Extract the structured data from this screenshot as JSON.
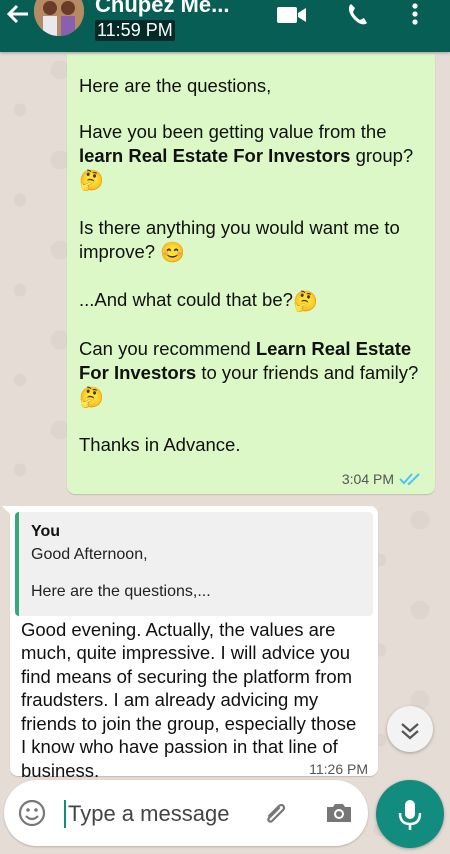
{
  "header": {
    "chat_name": "Chupez Me...",
    "time": "11:59 PM",
    "icons": [
      "back-arrow-icon",
      "video-call-icon",
      "phone-icon",
      "more-options-icon"
    ]
  },
  "outgoing": {
    "line1": "Here are the questions,",
    "q1_prefix": "Have you been getting value from the ",
    "q1_bold": "learn Real Estate For Investors",
    "q1_suffix": " group?",
    "q2": "Is there anything you would want me to improve?",
    "q3": "...And what could that be?",
    "q4_prefix": "Can you recommend ",
    "q4_bold": "Learn Real Estate For Investors",
    "q4_suffix": " to your friends and family?",
    "closing": "Thanks in Advance.",
    "time": "3:04 PM",
    "emoji_thinking": "🤔",
    "emoji_smile": "😊"
  },
  "incoming": {
    "quote_author": "You",
    "quote_line1": "Good Afternoon,",
    "quote_line2": "Here are the questions,...",
    "text": "Good evening. Actually, the values are much, quite impressive. I will advice you find means of securing the platform from fraudsters. I am already advicing my friends to join the group, especially those I know who have passion in that line of business.",
    "time": "11:26 PM"
  },
  "composer": {
    "placeholder": "Type a message"
  },
  "colors": {
    "header": "#075e54",
    "outgoing_bubble": "#dcf8c6",
    "accent": "#128c7e",
    "read_ticks": "#4fc3f7"
  }
}
